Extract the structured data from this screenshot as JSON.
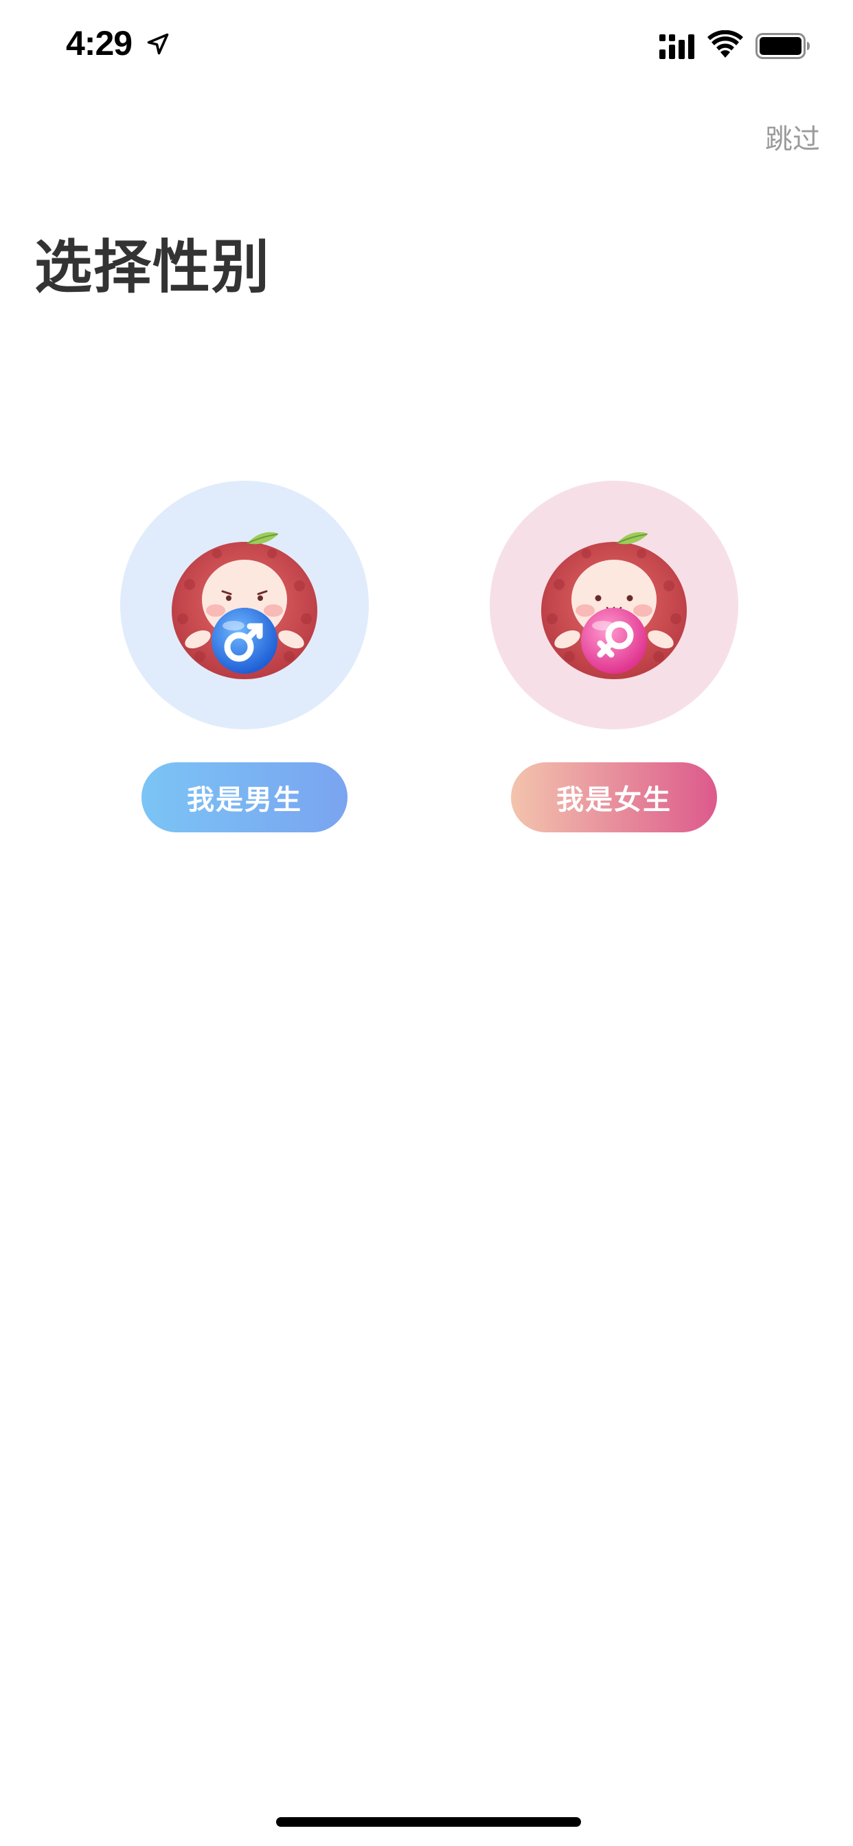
{
  "status_bar": {
    "time": "4:29",
    "icons": [
      "location-arrow-icon",
      "cellular-signal-icon",
      "wifi-icon",
      "battery-icon"
    ]
  },
  "header": {
    "skip_label": "跳过"
  },
  "main": {
    "title": "选择性别",
    "options": [
      {
        "id": "male",
        "label": "我是男生",
        "symbol": "♂",
        "circle_color": "#e0ecfb",
        "gradient": [
          "#7bc4f5",
          "#7aa4f0"
        ]
      },
      {
        "id": "female",
        "label": "我是女生",
        "symbol": "♀",
        "circle_color": "#f7dfe8",
        "gradient": [
          "#f3c4ad",
          "#dc5a8c"
        ]
      }
    ]
  }
}
